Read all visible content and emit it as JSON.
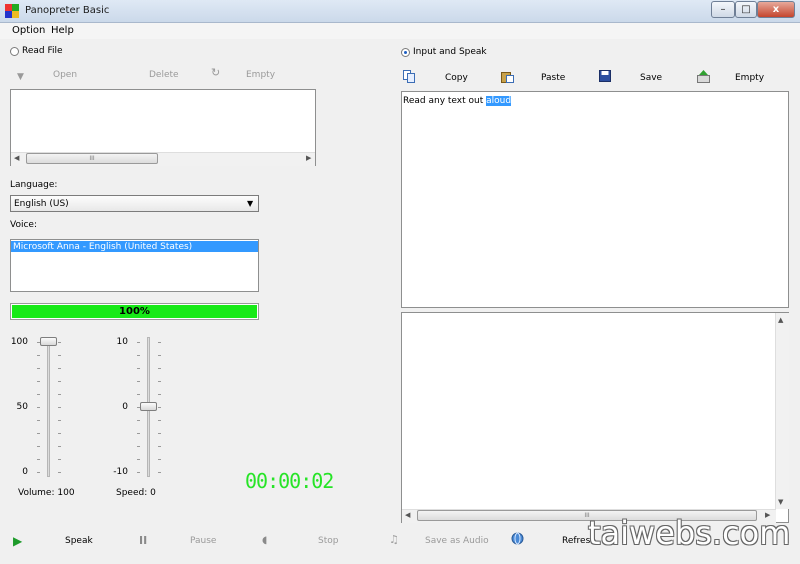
{
  "window": {
    "title": "Panopreter Basic",
    "min": "–",
    "max": "□",
    "close": "x"
  },
  "menu": [
    "Option",
    "Help"
  ],
  "left": {
    "read_file_label": "Read File",
    "toolbar": {
      "open": "Open",
      "delete": "Delete",
      "empty": "Empty"
    },
    "file_scroll_grip": "III",
    "language_label": "Language:",
    "language_value": "English (US)",
    "voice_label": "Voice:",
    "voice_selected": "Microsoft Anna - English (United States)",
    "progress": {
      "percent": 100,
      "text": "100%"
    },
    "volume": {
      "ticks": {
        "top": "100",
        "mid": "50",
        "bottom": "0"
      },
      "value": 100,
      "label": "Volume: 100"
    },
    "speed": {
      "ticks": {
        "top": "10",
        "mid": "0",
        "bottom": "-10"
      },
      "value": 0,
      "label": "Speed: 0"
    },
    "timer": "00:00:02"
  },
  "right": {
    "input_label": "Input and Speak",
    "toolbar": {
      "copy": "Copy",
      "paste": "Paste",
      "save": "Save",
      "empty": "Empty"
    },
    "text_before": "Read any text out ",
    "text_selected": "aloud",
    "output_scroll_grip": "III"
  },
  "bottom": {
    "speak": "Speak",
    "pause": "Pause",
    "stop": "Stop",
    "save_audio": "Save as Audio",
    "refresh": "Refresh"
  },
  "watermark": "taiwebs.com",
  "colors": {
    "accent": "#3399ff",
    "progress": "#17ea17",
    "timer": "#27e427"
  }
}
